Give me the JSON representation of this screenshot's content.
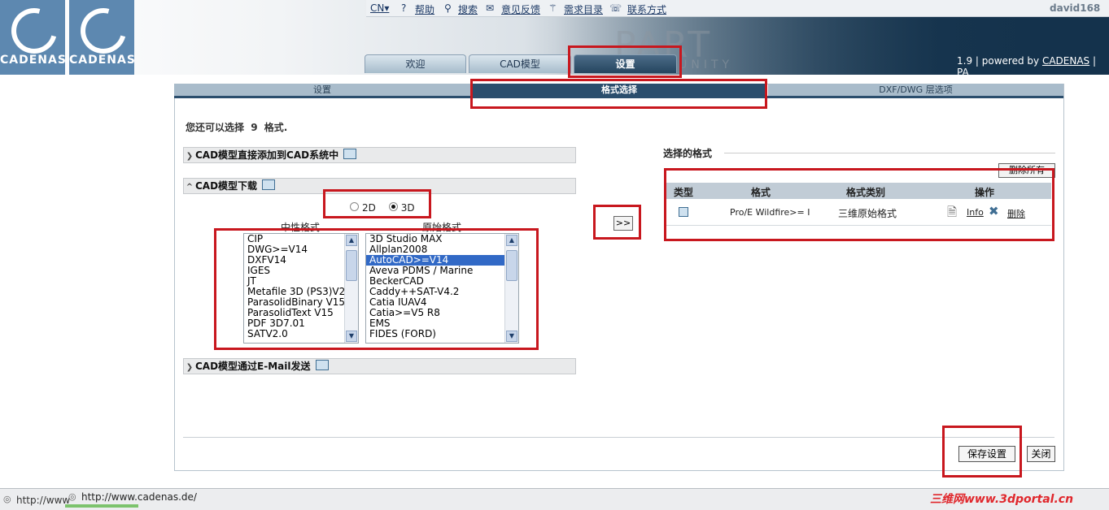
{
  "header": {
    "logo_text": "CADENAS",
    "top_links": [
      "CN▾",
      "?",
      "帮助",
      "搜索",
      "意见反馈",
      "需求目录",
      "联系方式"
    ],
    "user": "david168",
    "watermark_part": "PART",
    "watermark_community": "MMUNITY",
    "tabs": [
      "欢迎",
      "CAD模型",
      "设置"
    ],
    "active_tab": "设置",
    "version_prefix": "1.9 | powered by",
    "version_link": "CADENAS",
    "version_suffix": "| PA"
  },
  "subtabs": [
    "设置",
    "格式选择",
    "DXF/DWG 层选项"
  ],
  "active_subtab": "格式选择",
  "remaining": {
    "prefix": "您还可以选择",
    "count": "9",
    "suffix": "格式."
  },
  "sections": {
    "direct_add": "CAD模型直接添加到CAD系统中",
    "download": "CAD模型下载",
    "email": "CAD模型通过E-Mail发送"
  },
  "radio": {
    "option_2d": "2D",
    "option_3d": "3D",
    "selected": "3D"
  },
  "columns": {
    "neutral": "中性格式",
    "native": "原始格式"
  },
  "neutral_formats": [
    "CIP",
    "DWG>=V14",
    "DXFV14",
    "IGES",
    "JT",
    "Metafile 3D (PS3)V2",
    "ParasolidBinary V15",
    "ParasolidText V15",
    "PDF 3D7.01",
    "SATV2.0"
  ],
  "native_formats": [
    "3D Studio MAX",
    "Allplan2008",
    "AutoCAD>=V14",
    "Aveva PDMS / Marine",
    "BeckerCAD",
    "Caddy++SAT-V4.2",
    "Catia IUAV4",
    "Catia>=V5 R8",
    "EMS",
    "FIDES (FORD)"
  ],
  "native_selected": "AutoCAD>=V14",
  "add_button": ">>",
  "selected_panel": {
    "title": "选择的格式",
    "delete_all": "删除所有",
    "headers": [
      "类型",
      "格式",
      "格式类别",
      "操作"
    ],
    "row": {
      "format": "Pro/E Wildfire>= I",
      "category": "三维原始格式",
      "info": "Info",
      "delete": "删除"
    }
  },
  "buttons": {
    "save": "保存设置",
    "close": "关闭"
  },
  "status": {
    "url_left": "http://www",
    "url": "http://www.cadenas.de/",
    "portal": "三维网www.3dportal.cn"
  }
}
